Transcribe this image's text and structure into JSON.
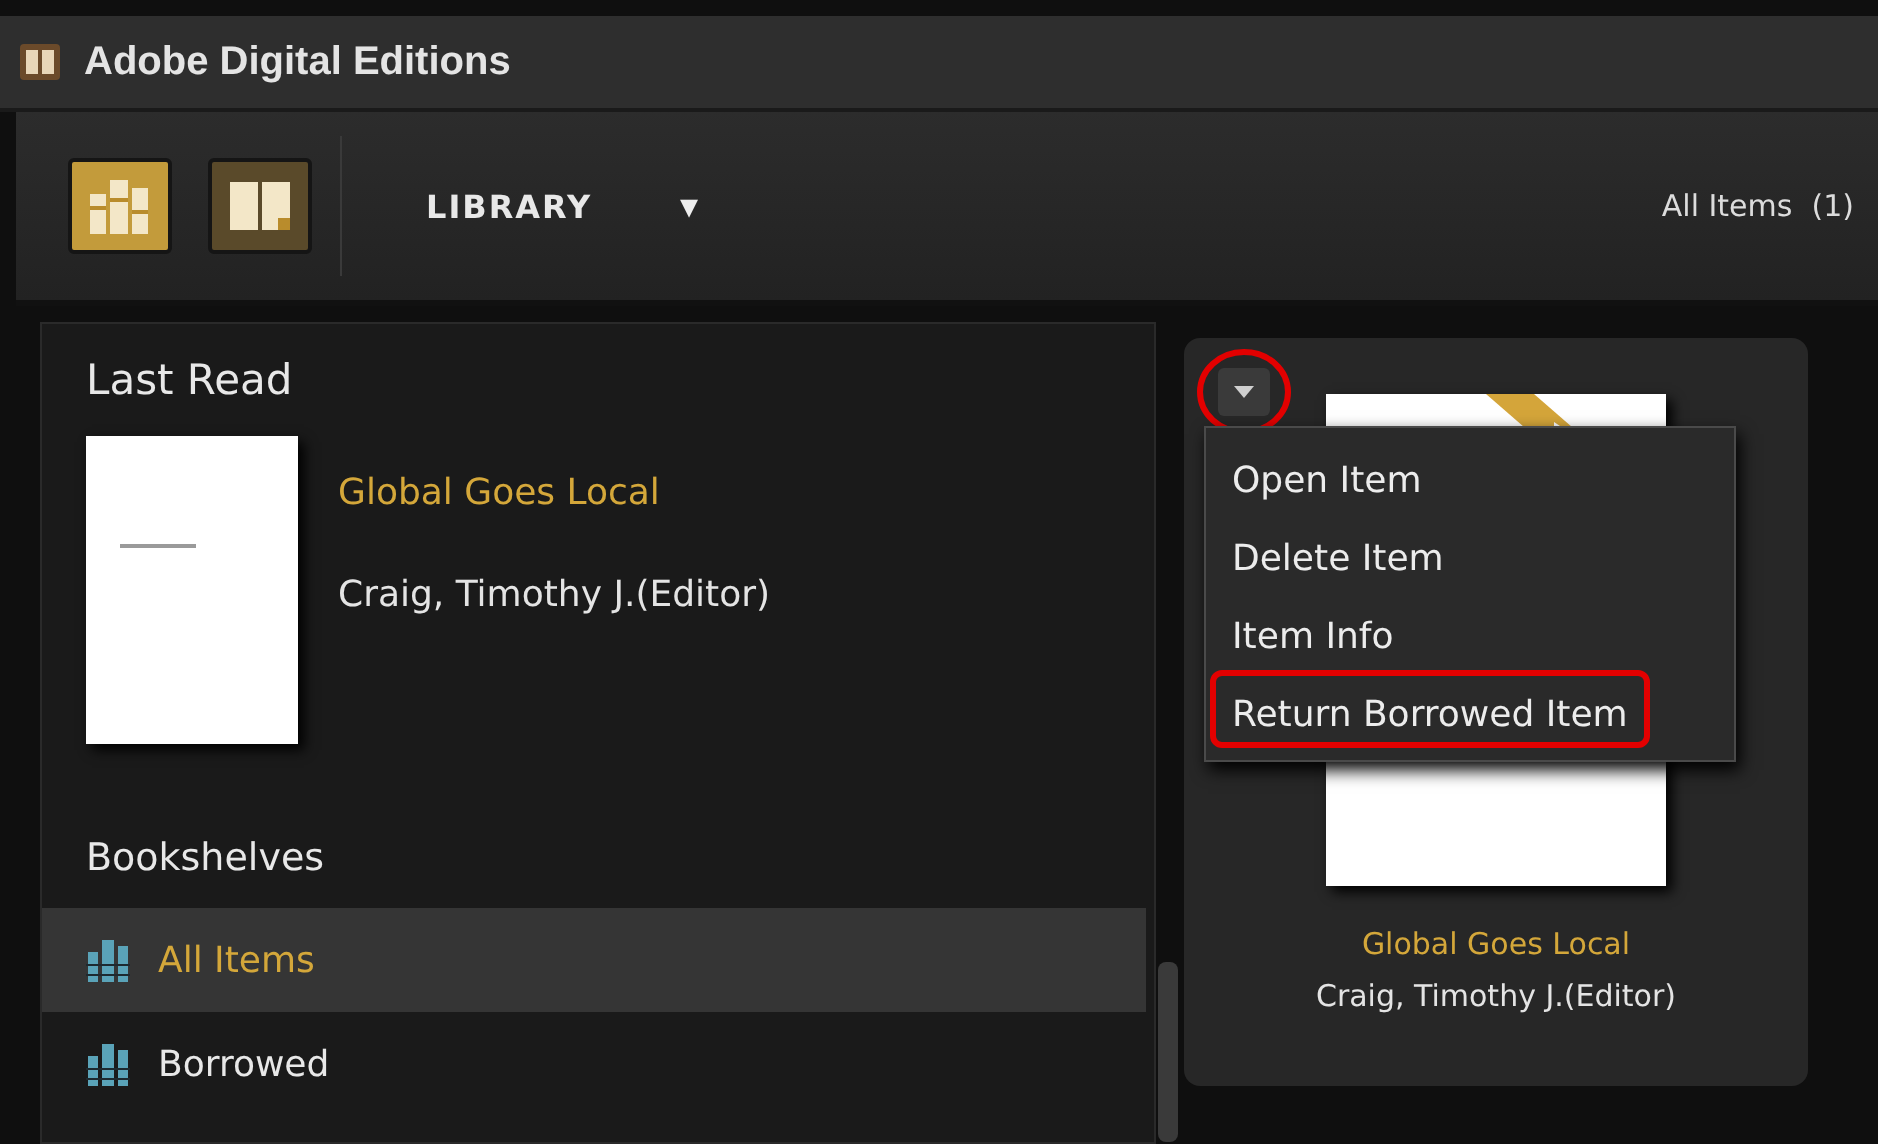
{
  "window": {
    "title": "Adobe Digital Editions"
  },
  "toolbar": {
    "views": [
      {
        "kind": "library",
        "selected": true
      },
      {
        "kind": "reading",
        "selected": false
      }
    ],
    "section": "LIBRARY",
    "caret": "▾",
    "count_label": "All Items  (1)"
  },
  "last_read": {
    "heading": "Last Read",
    "title": "Global Goes Local",
    "author": "Craig, Timothy J.(Editor)"
  },
  "bookshelves": {
    "heading": "Bookshelves",
    "items": [
      {
        "label": "All Items",
        "selected": true
      },
      {
        "label": "Borrowed",
        "selected": false
      }
    ]
  },
  "item_card": {
    "title": "Global Goes Local",
    "author": "Craig, Timothy J.(Editor)",
    "borrowed": true,
    "menu_button_annotated": true,
    "menu": [
      {
        "label": "Open Item",
        "annotated": false
      },
      {
        "label": "Delete Item",
        "annotated": false
      },
      {
        "label": "Item Info",
        "annotated": false
      },
      {
        "label": "Return Borrowed Item",
        "annotated": true
      }
    ]
  }
}
